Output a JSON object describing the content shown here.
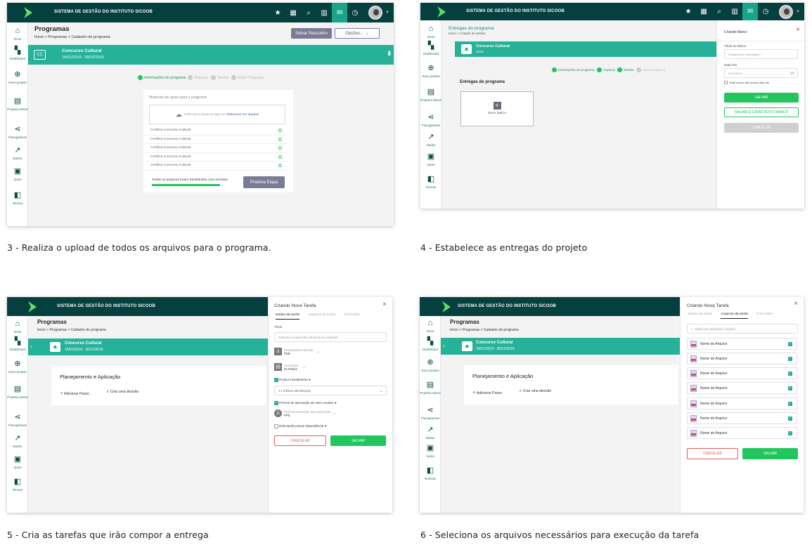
{
  "captions": {
    "s3": "3 - Realiza o upload de todos os arquivos para o programa.",
    "s4": "4 - Estabelece as entregas do projeto",
    "s5": "5 - Cria as tarefas que irão compor a entrega",
    "s6": "6 - Seleciona os arquivos necessários para execução da tarefa"
  },
  "app": {
    "title": "SISTEMA DE GESTÃO DO INSTITUTO SICOOB",
    "title_alt": "SISTEMA  DE GESTÃO DO INSTITUTO SICOOB",
    "brand_color": "#05403e",
    "accent_color": "#26b199",
    "icons": [
      "star-icon",
      "grid-icon",
      "search-icon",
      "chart-icon",
      "inbox-icon",
      "clock-icon"
    ]
  },
  "sidebar": {
    "items": [
      {
        "label": "Início",
        "icon": "home-icon"
      },
      {
        "label": "Dashboard",
        "icon": "dashboard-icon"
      },
      {
        "label": "Novo projeto",
        "icon": "plus-circle-icon"
      },
      {
        "label": "Projetos ativos",
        "icon": "projects-icon"
      },
      {
        "label": "Fluxogramas",
        "icon": "flow-icon"
      },
      {
        "label": "Dados",
        "icon": "trend-icon"
      },
      {
        "label": "Apoio",
        "icon": "support-icon"
      },
      {
        "label": "Termos",
        "icon": "terms-icon"
      },
      {
        "label": "Notícias",
        "icon": "news-icon"
      }
    ]
  },
  "shared": {
    "programas": "Programas",
    "breadcrumb": "Início > Programas > Cadastro de programa",
    "program_name": "Concurso Cultural",
    "program_dates": "14/01/2019 - 30/12/2019",
    "badge": "CC",
    "steps": [
      "Informações do programa",
      "Arquivos",
      "Tarefas",
      "Ativar Programa"
    ]
  },
  "s3": {
    "save_draft": "Salvar Rascunho",
    "options": "Opções...",
    "support_title": "Materiais de apoio para o programa",
    "drop_text": "Solte seus arquivos aqui ou",
    "drop_link": "Selecione um arquivo",
    "files": [
      "Certifica Concurso Cultural",
      "Certifica Concurso Cultural",
      "Certifica Concurso Cultural",
      "Certifica Concurso Cultural",
      "Certifica Concurso Cultural"
    ],
    "success": "Todos os arquivos foram transferidos com sucesso",
    "upload_progress": 1.0,
    "next": "Próxima Etapa"
  },
  "s4": {
    "title": "Entregas do programa",
    "crumb": "Início > Criação de tarefas",
    "year": "2019",
    "section": "Entregas do programa",
    "new_marco": "Novo Marco",
    "panel_title": "Criando Marco",
    "field_title": "Título do Marco",
    "field_title_ph": "Planejamento Estratégico",
    "field_date": "Data Fim",
    "field_date_val": "30/12/2019",
    "no_date": "Este marco não possui data fim",
    "save": "SALVAR",
    "save_new": "SALVAR E CRIAR NOVO MARCO",
    "cancel": "CANCELAR"
  },
  "s5": {
    "section": "Planejamento e Aplicação",
    "add_step": "Adicionar Passo",
    "decision": "Criar uma decisão",
    "panel_title": "Criando Nova Tarefa",
    "tabs": [
      "Dados da tarefa",
      "Arquivos da tarefa",
      "Formulário"
    ],
    "field_title": "Título",
    "field_title_ph": "Solicitar a impressão da prova do material",
    "resp_label": "Responsável Indicado",
    "resp_value": "PDE",
    "score_label": "Pontuação",
    "score_value": "25 Pontos",
    "invest": "Possui Investimento",
    "invest_value": "1.1 Rúbrica Identificação",
    "approval": "Precisa de aprovação de outro usuário",
    "approver_label": "Perfil recomendado para aprovação",
    "approver_value": "PPE",
    "dependency": "Esta tarefa possui dependência",
    "cancel": "CANCELAR",
    "save": "SALVAR"
  },
  "s6": {
    "panel_title": "Criando Nova Tarefa",
    "tabs": [
      "Dados da tarefa",
      "Arquivos da tarefa",
      "Formulário"
    ],
    "search_ph": "Digite para pesquisar o arquivo",
    "files": [
      "Nome do Arquivo",
      "Nome do Arquivo",
      "Nome do Arquivo",
      "Nome do Arquivo",
      "Nome do Arquivo",
      "Nome do Arquivo",
      "Nome do Arquivo"
    ],
    "cancel": "CANCELAR",
    "save": "SALVAR"
  }
}
